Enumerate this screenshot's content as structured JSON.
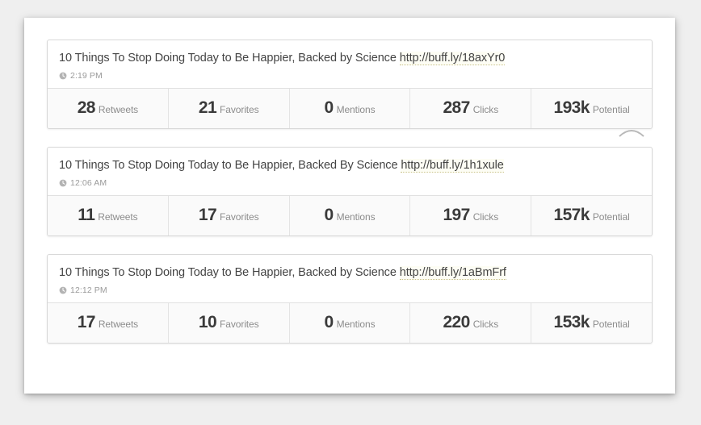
{
  "icons": {
    "clock": "clock-icon",
    "caret": "caret-up-icon"
  },
  "posts": [
    {
      "title_text": "10 Things To Stop Doing Today to Be Happier, Backed by Science ",
      "link": "http://buff.ly/18axYr0",
      "timestamp": "2:19 PM",
      "stats": [
        {
          "value": "28",
          "label": "Retweets"
        },
        {
          "value": "21",
          "label": "Favorites"
        },
        {
          "value": "0",
          "label": "Mentions"
        },
        {
          "value": "287",
          "label": "Clicks"
        },
        {
          "value": "193k",
          "label": "Potential"
        }
      ]
    },
    {
      "title_text": "10 Things To Stop Doing Today to Be Happier, Backed By Science ",
      "link": "http://buff.ly/1h1xule",
      "timestamp": "12:06 AM",
      "stats": [
        {
          "value": "11",
          "label": "Retweets"
        },
        {
          "value": "17",
          "label": "Favorites"
        },
        {
          "value": "0",
          "label": "Mentions"
        },
        {
          "value": "197",
          "label": "Clicks"
        },
        {
          "value": "157k",
          "label": "Potential"
        }
      ]
    },
    {
      "title_text": "10 Things To Stop Doing Today to Be Happier, Backed by Science ",
      "link": "http://buff.ly/1aBmFrf",
      "timestamp": "12:12 PM",
      "stats": [
        {
          "value": "17",
          "label": "Retweets"
        },
        {
          "value": "10",
          "label": "Favorites"
        },
        {
          "value": "0",
          "label": "Mentions"
        },
        {
          "value": "220",
          "label": "Clicks"
        },
        {
          "value": "153k",
          "label": "Potential"
        }
      ]
    }
  ],
  "colors": {
    "page_background": "#efefef",
    "panel": "#ffffff",
    "card_border": "#d8d8d8",
    "stats_background": "#fafafa",
    "value_text": "#3a3a3a",
    "label_text": "#8c8c8c",
    "muted_text": "#9a9a9a",
    "link_underline": "#c9c28a"
  }
}
